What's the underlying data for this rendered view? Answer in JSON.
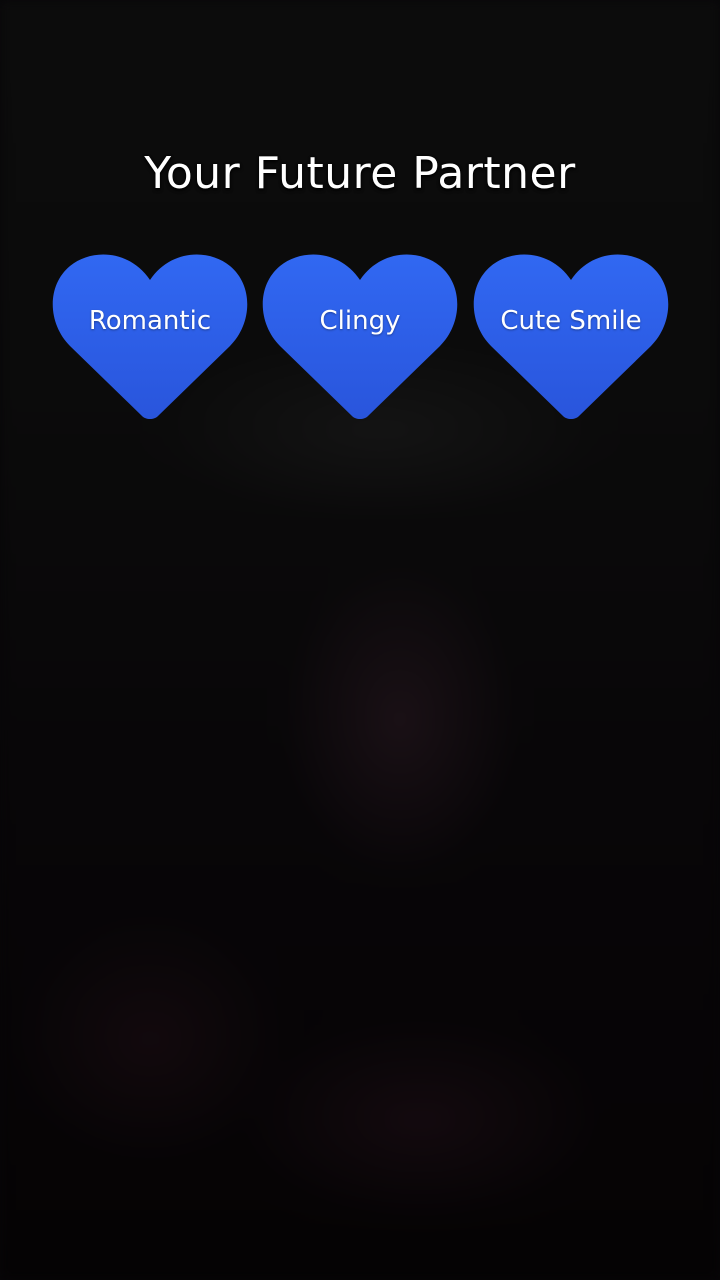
{
  "title": "Your Future Partner",
  "colors": {
    "heart_fill_top": "#3065F0",
    "heart_fill_bottom": "#2A58E0",
    "text": "#FFFFFF",
    "background": "#070608"
  },
  "options": [
    {
      "label": "Romantic",
      "icon": "heart-shape"
    },
    {
      "label": "Clingy",
      "icon": "heart-shape"
    },
    {
      "label": "Cute Smile",
      "icon": "heart-shape"
    }
  ]
}
